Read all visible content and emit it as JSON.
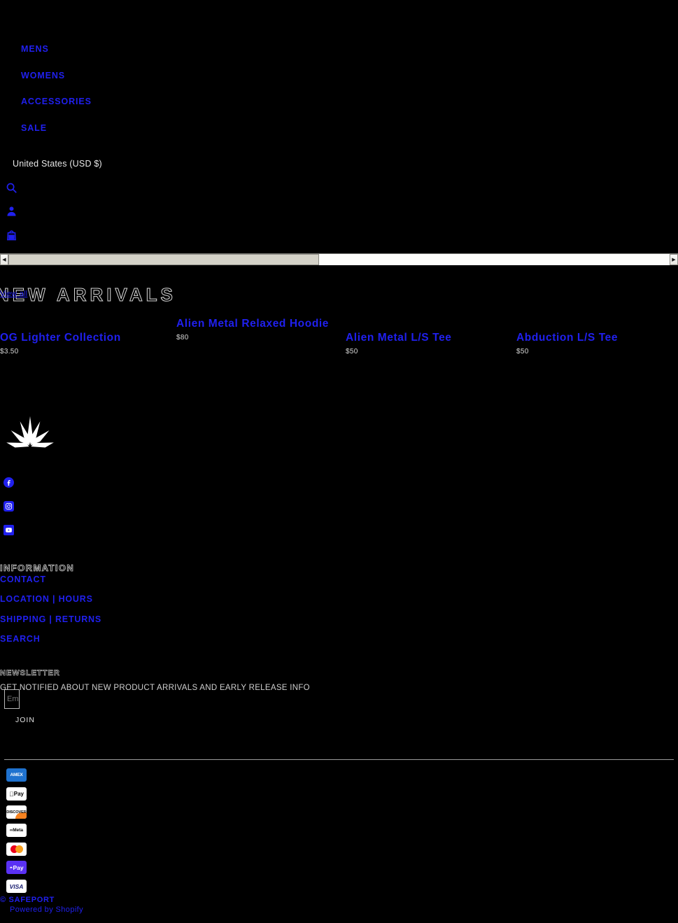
{
  "nav": {
    "items": [
      {
        "label": "MENS"
      },
      {
        "label": "WOMENS"
      },
      {
        "label": "ACCESSORIES"
      },
      {
        "label": "SALE"
      }
    ]
  },
  "localization": {
    "country_selector": "United States (USD $)"
  },
  "header_icons": {
    "search": "search-icon",
    "account": "account-icon",
    "cart": "cart-icon"
  },
  "scrollbar": {
    "left_arrow": "◀",
    "right_arrow": "▶"
  },
  "new_arrivals": {
    "title": "NEW ARRIVALS",
    "view_all": "View all",
    "products": [
      {
        "title": "OG Lighter Collection",
        "price": "$3.50"
      },
      {
        "title": "Alien Metal Relaxed Hoodie",
        "price": "$80"
      },
      {
        "title": "Alien Metal L/S Tee",
        "price": "$50"
      },
      {
        "title": "Abduction L/S Tee",
        "price": "$50"
      }
    ]
  },
  "footer": {
    "logo_name": "safeport-sunburst-logo",
    "social": [
      {
        "name": "facebook-icon"
      },
      {
        "name": "instagram-icon"
      },
      {
        "name": "youtube-icon"
      }
    ],
    "information": {
      "heading": "INFORMATION",
      "links": [
        {
          "label": "CONTACT"
        },
        {
          "label": "LOCATION | HOURS"
        },
        {
          "label": "SHIPPING | RETURNS"
        },
        {
          "label": "SEARCH"
        }
      ]
    },
    "newsletter": {
      "heading": "NEWSLETTER",
      "description": "GET NOTIFIED ABOUT NEW PRODUCT ARRIVALS AND EARLY RELEASE INFO",
      "input_placeholder": "Email",
      "submit_label": "JOIN"
    },
    "payment_methods": [
      {
        "label": "AMEX",
        "name": "amex-icon"
      },
      {
        "label": "Pay",
        "name": "apple-pay-icon"
      },
      {
        "label": "DISCOVER",
        "name": "discover-icon"
      },
      {
        "label": "Meta",
        "name": "meta-pay-icon"
      },
      {
        "label": "",
        "name": "mastercard-icon"
      },
      {
        "label": "Pay",
        "name": "shop-pay-icon"
      },
      {
        "label": "VISA",
        "name": "visa-icon"
      }
    ],
    "copyright": "© SAFEPORT",
    "powered_by": "Powered by Shopify"
  },
  "colors": {
    "background": "#000000",
    "link": "#2020ee",
    "text": "#d7d7d7"
  }
}
